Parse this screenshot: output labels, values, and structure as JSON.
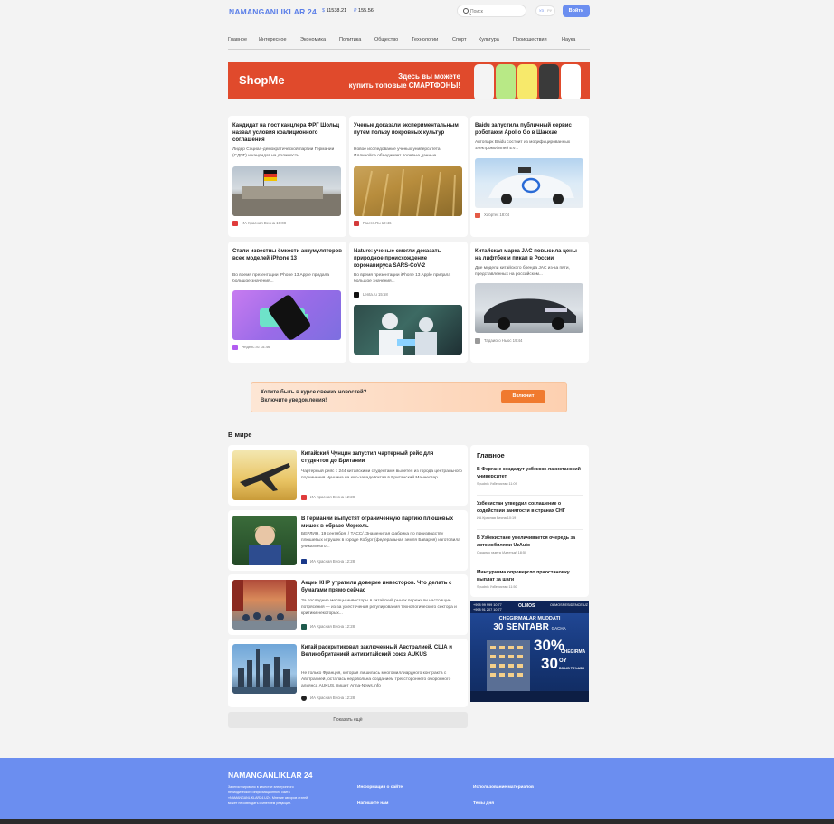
{
  "header": {
    "logo": "NAMANGANLIKLAR 24",
    "usd_sign": "$",
    "usd_value": "11538.21",
    "rub_sign": "₽",
    "rub_value": "155.56",
    "search_placeholder": "Поиск",
    "lang_uz": "УЗ",
    "lang_ru": "РУ",
    "login_label": "Войти"
  },
  "nav": [
    "Главное",
    "Интересное",
    "Экономика",
    "Политика",
    "Общество",
    "Технологии",
    "Спорт",
    "Культура",
    "Происшествия",
    "Наука"
  ],
  "banner": {
    "brand": "ShopMe",
    "line1": "Здесь вы можете",
    "line2": "купить топовые СМАРТФОНЫ!",
    "colors": [
      "#e04a2c"
    ]
  },
  "cards": [
    {
      "title": "Кандидат на пост канцлера ФРГ Шольц назвал условия коалиционного соглашения",
      "desc": "Лидер Социал-демократической партии Германии (СДПГ) и кандидат на должность...",
      "source": "ИА Красная Весна 19:08"
    },
    {
      "title": "Ученые доказали экспериментальным путем пользу покровных культур",
      "desc": "Новое исследование ученых университета Иллинойса объединяет полевые данные...",
      "source": "Газета.Ru 12:46"
    },
    {
      "title": "Baidu запустила публичный сервис роботакси Apollo Go в Шанхае",
      "desc": "Автопарк Baidu состоит из модифицированных электромобилей EV...",
      "source": "Хабртек 18:04"
    },
    {
      "title": "Стали известны ёмкости аккумуляторов всех моделей iPhone 13",
      "desc": "Во время презентации iPhone 13 Apple придала большое значения...",
      "source": "Яндекс.ru 15:46"
    },
    {
      "title": "Nature: ученые смогли доказать природное происхождение коронавируса SARS-CoV-2",
      "desc": "Во время презентации iPhone 13 Apple придала большое значения...",
      "source": "Lenta.ru 15:58"
    },
    {
      "title": "Китайская марка JAC повысила цены на лифтбек и пикап в России",
      "desc": "Две модели китайского бренда JAC из-за пяти, представленных на российском...",
      "source": "Тадаиско Ньюс 19:44"
    }
  ],
  "promo": {
    "line1": "Хотите быть в курсе свежих новостей?",
    "line2": "Включите уведомления!",
    "button": "Включит"
  },
  "world": {
    "title": "В мире",
    "items": [
      {
        "title": "Китайский Чунцин запустил чартерный рейс для студентов до Британии",
        "desc": "Чартерный рейс с 244 китайскими студентами вылетел из города центрального подчинения Чунцина на юго-западе Китая в Британский Манчестер...",
        "source": "ИА Красная Весна 12:28"
      },
      {
        "title": "В Германии выпустят ограниченную партию плюшевых мишек в образе Меркель",
        "desc": "БЕРЛИН, 19 сентября. / ТАСС/. Знаменитая фабрика по производству плюшевых игрушек в городе Кобург (федеральная земля Бавария) изготовила уникального...",
        "source": "ИА Красная Весна 12:28"
      },
      {
        "title": "Акции КНР утратили доверие инвесторов. Что делать с бумагами прямо сейчас",
        "desc": "За последние месяцы инвесторы в китайский рынок пережили настоящие потрясения — из-за ужесточения регулирования технологического сектора и критики некоторых...",
        "source": "ИА Красная Весна 12:28"
      },
      {
        "title": "Китай раскритиковал заключенный Австралией, США и Великобританией антикитайский союз AUKUS",
        "desc": "Не только Франция, которая лишилась многомиллиардного контракта с Австралией, осталась недовольна созданием трехстороннего оборонного альянса AUKUS, пишет Anna-News.info",
        "source": "ИА Красная Весна 12:28"
      }
    ],
    "more_label": "Показать ещё"
  },
  "sidebar": {
    "title": "Главное",
    "items": [
      {
        "title": "В Фергане создадут узбекско-пакистанский университет",
        "source": "Spudnik Узбекистан 11:09"
      },
      {
        "title": "Узбекистан утвердил соглашение о содействии занятости в странах СНГ",
        "source": "ИА Красная Весна 10:19"
      },
      {
        "title": "В Узбекистане увеличивается очередь за автомобилями UzAuto",
        "source": "Озодлик газета (Азаттык) 18:50"
      },
      {
        "title": "Минтуризма опровергло приостановку выплат за шаги",
        "source": "Spudnik Узбекистан 11:50"
      }
    ]
  },
  "ad": {
    "brand": "OLMOS",
    "phone1": "+998 99 999 10 77",
    "phone2": "+998 91 207 10 77",
    "site": "OLMOSRESIDENCE.UZ",
    "headline": "CHEGIRMALAR MUDDATI",
    "date": "30 SENTABR",
    "date_suffix": "GACHA",
    "pct": "30%",
    "pct_label": "CHEGIRMA",
    "months": "30",
    "months_label": "OY",
    "months_sub": "BO'LIB TO'LASH"
  },
  "footer": {
    "logo": "NAMANGANLIKLAR 24",
    "desc": "Зарегистрировано в качестве электронного периодического информационного сайта «NAMANGANLIKLAR24.UZ». Мнение авторов статей может не совпадать с мнением редакции.",
    "link1": "Информация о сайте",
    "link2": "Напишите нам",
    "link3": "Использование материалов",
    "link4": "Темы дня"
  }
}
